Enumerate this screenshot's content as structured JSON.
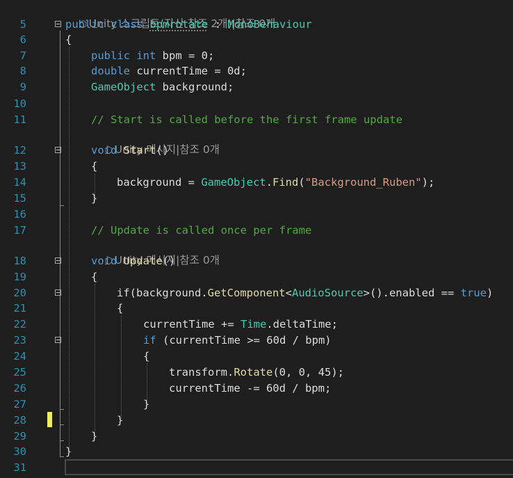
{
  "codelens": {
    "class_refs": "Unity 스크립트(자산 참조 2개)|참조 0개",
    "start_refs": "Unity 메시지|참조 0개",
    "update_refs": "Unity 메시지|참조 0개",
    "icon": "unity-cube-icon"
  },
  "line_numbers": [
    "5",
    "6",
    "7",
    "8",
    "9",
    "10",
    "11",
    "12",
    "13",
    "14",
    "15",
    "16",
    "17",
    "18",
    "19",
    "20",
    "21",
    "22",
    "23",
    "24",
    "25",
    "26",
    "27",
    "28",
    "29",
    "30",
    "31"
  ],
  "code": {
    "l5": {
      "kw1": "public",
      "kw2": "class",
      "name": "bpmrotate",
      "sep": " : ",
      "base": "MonoBehaviour"
    },
    "l6": "{",
    "l7": {
      "kw1": "public",
      "kw2": "int",
      "rest": " bpm = 0;"
    },
    "l8": {
      "kw1": "double",
      "rest": " currentTime = 0d;"
    },
    "l9": {
      "type": "GameObject",
      "rest": " background;"
    },
    "l11": "// Start is called before the first frame update",
    "l12": {
      "kw": "void",
      "name": "Start",
      "rest": "()"
    },
    "l13": "{",
    "l14": {
      "pre": "background = ",
      "type": "GameObject",
      "dot": ".",
      "method": "Find",
      "open": "(",
      "str": "\"Background_Ruben\"",
      "close": ");"
    },
    "l15": "}",
    "l17": "// Update is called once per frame",
    "l18": {
      "kw": "void",
      "name": "Update",
      "rest": "()"
    },
    "l19": "{",
    "l20": {
      "pre": "if(background.",
      "method": "GetComponent",
      "lt": "<",
      "type": "AudioSource",
      "rest": ">().enabled == ",
      "kw": "true",
      "close": ")"
    },
    "l21": "{",
    "l22": {
      "pre": "currentTime += ",
      "type": "Time",
      "rest": ".deltaTime;"
    },
    "l23": {
      "kw": "if",
      "rest": " (currentTime >= 60d / bpm)"
    },
    "l24": "{",
    "l25": {
      "pre": "transform.",
      "method": "Rotate",
      "rest": "(0, 0, 45);"
    },
    "l26": "currentTime -= 60d / bpm;",
    "l27": "}",
    "l28": "}",
    "l29": "}",
    "l30": "}"
  },
  "colors": {
    "background": "#1e1e1e",
    "keyword": "#569cd6",
    "type": "#4ec9b0",
    "method": "#dcdcaa",
    "comment": "#57a64a",
    "string": "#d69d85",
    "line_number": "#2b91af",
    "change_marker": "#eeee66"
  }
}
